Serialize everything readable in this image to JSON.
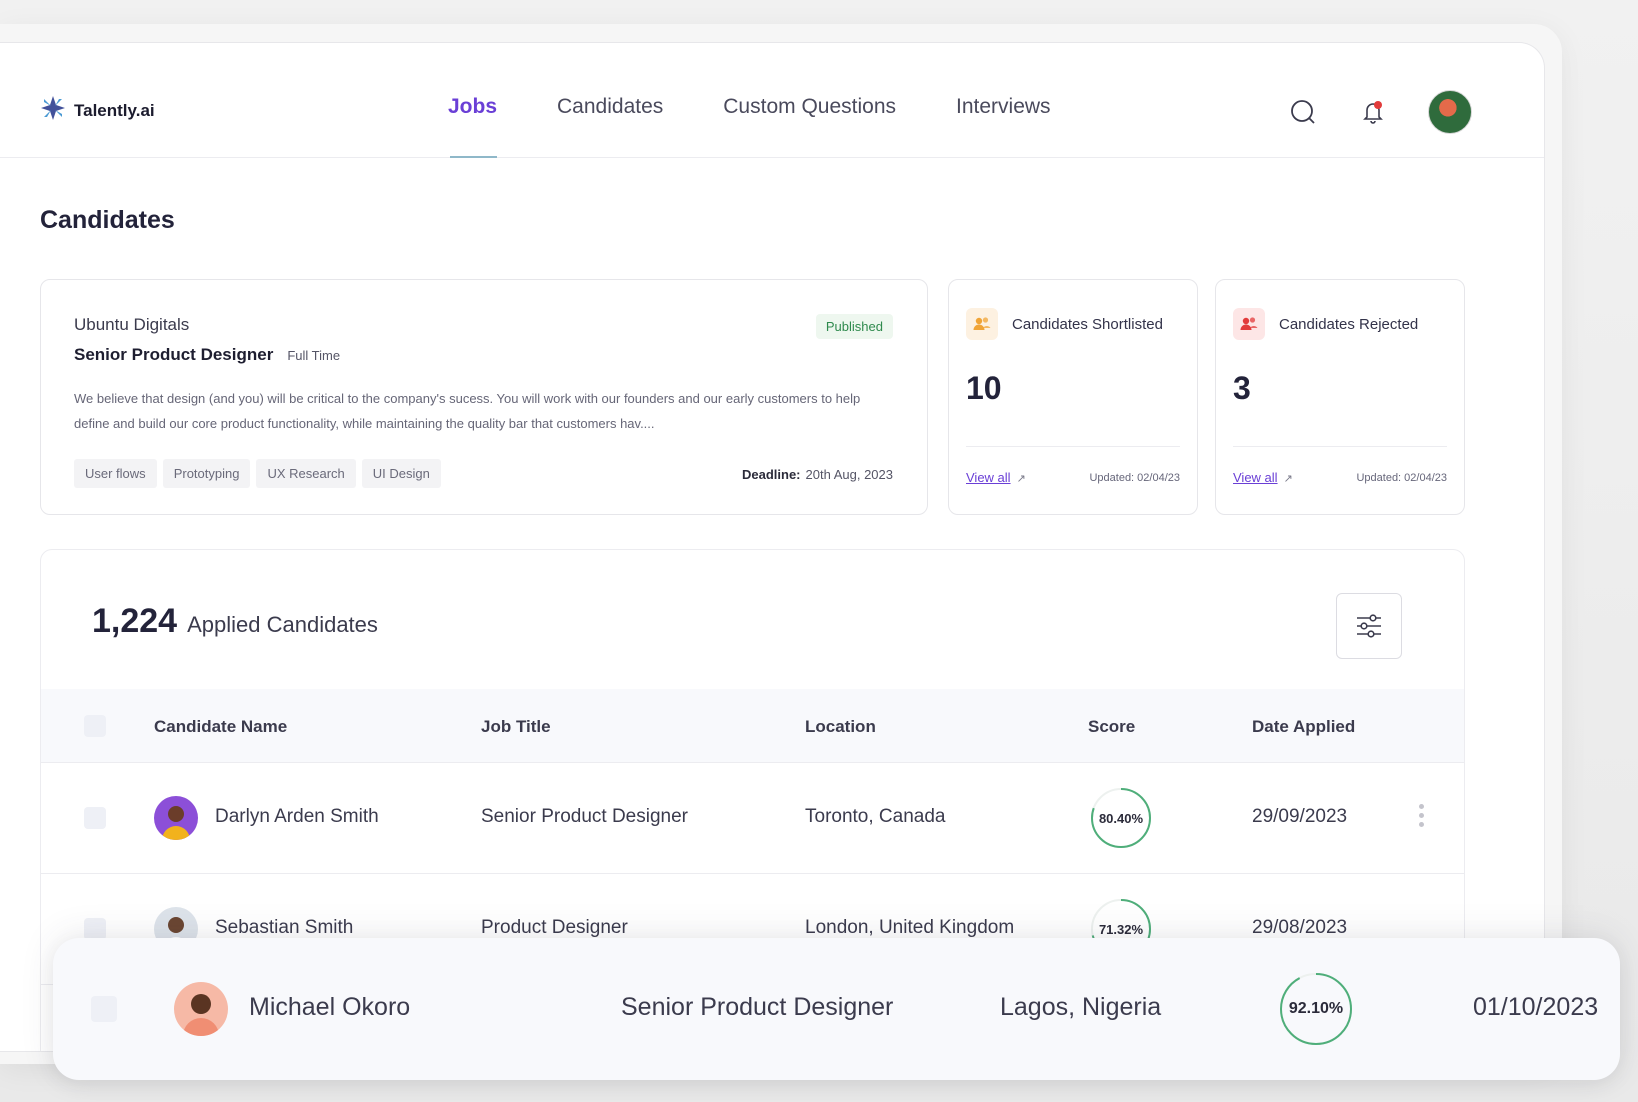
{
  "app": {
    "brand": "Talently.ai"
  },
  "nav": {
    "links": [
      "Jobs",
      "Candidates",
      "Custom Questions",
      "Interviews"
    ],
    "active": "Jobs"
  },
  "page": {
    "title": "Candidates"
  },
  "job": {
    "company": "Ubuntu Digitals",
    "title": "Senior Product Designer",
    "type": "Full Time",
    "status": "Published",
    "description": "We believe that design (and you) will be critical to the company's sucess. You will work with our founders and our early customers to help define and build our core product functionality, while maintaining the quality bar that customers hav....",
    "tags": [
      "User flows",
      "Prototyping",
      "UX Research",
      "UI Design"
    ],
    "deadline_label": "Deadline:",
    "deadline_value": "20th Aug, 2023"
  },
  "stats": [
    {
      "label": "Candidates Shortlisted",
      "value": "10",
      "link": "View all",
      "updated": "Updated: 02/04/23",
      "color": "#f0a437"
    },
    {
      "label": "Candidates Rejected",
      "value": "3",
      "link": "View all",
      "updated": "Updated: 02/04/23",
      "color": "#e23b3b"
    }
  ],
  "applied": {
    "count": "1,224",
    "label": "Applied Candidates"
  },
  "table": {
    "columns": [
      "Candidate Name",
      "Job Title",
      "Location",
      "Score",
      "Date Applied"
    ],
    "rows": [
      {
        "name": "Darlyn Arden Smith",
        "job": "Senior Product Designer",
        "location": "Toronto, Canada",
        "score": "80.40%",
        "score_value": 80.4,
        "date": "29/09/2023"
      },
      {
        "name": "Sebastian Smith",
        "job": "Product Designer",
        "location": "London, United Kingdom",
        "score": "71.32%",
        "score_value": 71.32,
        "date": "29/08/2023"
      }
    ],
    "highlight": {
      "name": "Michael Okoro",
      "job": "Senior Product Designer",
      "location": "Lagos, Nigeria",
      "score": "92.10%",
      "score_value": 92.1,
      "date": "01/10/2023"
    }
  },
  "colors": {
    "accent": "#6a3fd6",
    "score_ring": "#4fae7a",
    "published": "#2f8a4d"
  },
  "icons": [
    "logo-icon",
    "search-icon",
    "bell-icon",
    "users-icon",
    "filter-icon",
    "kebab-icon"
  ]
}
